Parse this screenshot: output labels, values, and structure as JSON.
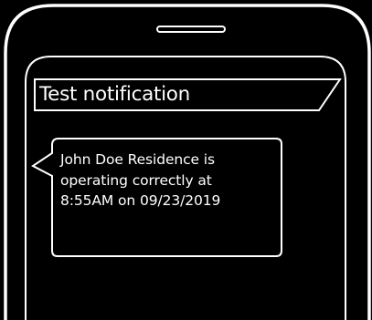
{
  "notification": {
    "title": "Test notification",
    "message_lines": [
      "John Doe Residence is",
      "operating correctly at",
      "8:55AM on 09/23/2019"
    ]
  },
  "colors": {
    "background": "#000000",
    "outline": "#ffffff",
    "text": "#ffffff"
  }
}
